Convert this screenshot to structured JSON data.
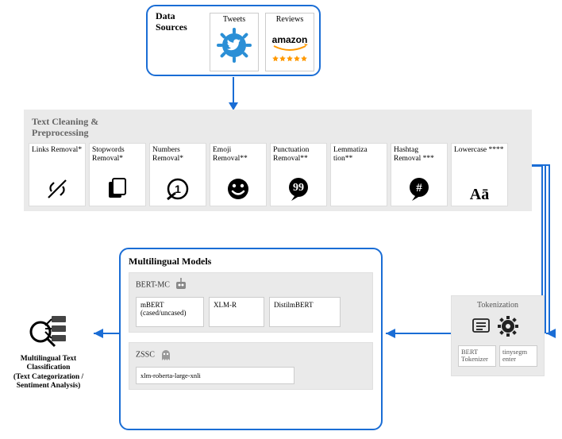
{
  "dataSources": {
    "title": "Data Sources",
    "items": [
      {
        "label": "Tweets",
        "icon": "twitter-gear"
      },
      {
        "label": "Reviews",
        "icon": "amazon-stars"
      }
    ]
  },
  "preprocessing": {
    "title": "Text Cleaning & Preprocessing",
    "steps": [
      {
        "name": "Links Removal*",
        "icon": "link-off"
      },
      {
        "name": "Stopwords Removal*",
        "icon": "copy-docs"
      },
      {
        "name": "Numbers Removal*",
        "icon": "number-off"
      },
      {
        "name": "Emoji Removal**",
        "icon": "smile"
      },
      {
        "name": "Punctuation Removal**",
        "icon": "quote-bubble"
      },
      {
        "name": "Lemmatiza tion**",
        "icon": "none"
      },
      {
        "name": "Hashtag Removal ***",
        "icon": "hash-bubble"
      },
      {
        "name": "Lowercase ****",
        "icon": "Aa"
      }
    ]
  },
  "models": {
    "title": "Multilingual Models",
    "bert_mc": {
      "title": "BERT-MC",
      "items": [
        {
          "name": "mBERT (cased/uncased)"
        },
        {
          "name": "XLM-R"
        },
        {
          "name": "DistilmBERT"
        }
      ]
    },
    "zssc": {
      "title": "ZSSC",
      "items": [
        {
          "name": "xlm-roberta-large-xnli"
        }
      ]
    }
  },
  "tokenization": {
    "title": "Tokenization",
    "items": [
      {
        "name": "BERT Tokenizer"
      },
      {
        "name": "tinysegm enter"
      }
    ]
  },
  "output": {
    "title": "Multilingual Text Classification",
    "sub": "(Text Categorization / Sentiment Analysis)"
  },
  "flow": [
    "dataSources -> preprocessing",
    "preprocessing -> tokenization",
    "tokenization -> models",
    "models -> output"
  ]
}
